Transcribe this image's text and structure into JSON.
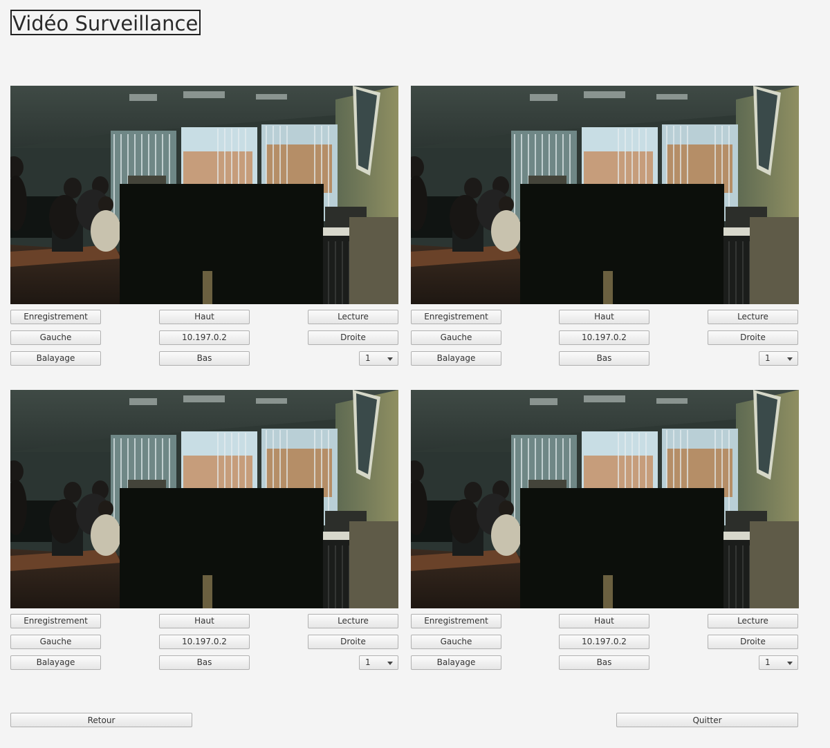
{
  "window": {
    "title": "Vidéo Surveillance"
  },
  "cameras": [
    {
      "record_label": "Enregistrement",
      "up_label": "Haut",
      "play_label": "Lecture",
      "left_label": "Gauche",
      "ip_label": "10.197.0.2",
      "right_label": "Droite",
      "scan_label": "Balayage",
      "down_label": "Bas",
      "speed_value": "1"
    },
    {
      "record_label": "Enregistrement",
      "up_label": "Haut",
      "play_label": "Lecture",
      "left_label": "Gauche",
      "ip_label": "10.197.0.2",
      "right_label": "Droite",
      "scan_label": "Balayage",
      "down_label": "Bas",
      "speed_value": "1"
    },
    {
      "record_label": "Enregistrement",
      "up_label": "Haut",
      "play_label": "Lecture",
      "left_label": "Gauche",
      "ip_label": "10.197.0.2",
      "right_label": "Droite",
      "scan_label": "Balayage",
      "down_label": "Bas",
      "speed_value": "1"
    },
    {
      "record_label": "Enregistrement",
      "up_label": "Haut",
      "play_label": "Lecture",
      "left_label": "Gauche",
      "ip_label": "10.197.0.2",
      "right_label": "Droite",
      "scan_label": "Balayage",
      "down_label": "Bas",
      "speed_value": "1"
    }
  ],
  "footer": {
    "back_label": "Retour",
    "quit_label": "Quitter"
  }
}
